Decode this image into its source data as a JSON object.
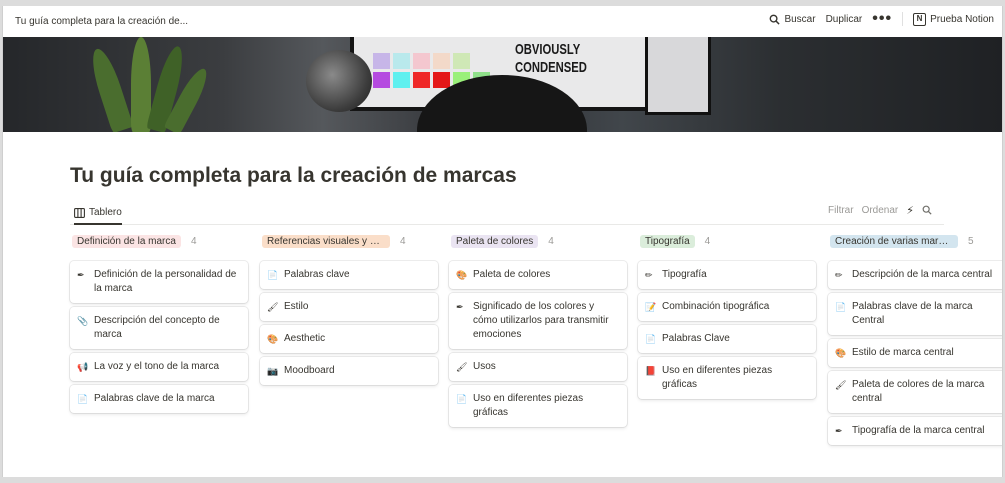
{
  "topbar": {
    "breadcrumb": "Tu guía completa para la creación de...",
    "search_label": "Buscar",
    "duplicate_label": "Duplicar",
    "more_label": "•••",
    "notion_label": "Prueba Notion"
  },
  "cover": {
    "text_line1": "OBVIOUSLY",
    "text_line2": "CONDENSED"
  },
  "page": {
    "title": "Tu guía completa para la creación de marcas"
  },
  "view": {
    "tab_label": "Tablero",
    "filter_label": "Filtrar",
    "sort_label": "Ordenar"
  },
  "columns": [
    {
      "title": "Definición de la marca",
      "count": "4",
      "color": "#fbe4e4",
      "cards": [
        {
          "icon": "pen-icon",
          "glyph": "✒",
          "text": "Definición de la personalidad de la marca"
        },
        {
          "icon": "paperclip-icon",
          "glyph": "📎",
          "text": "Descripción del concepto de marca"
        },
        {
          "icon": "megaphone-icon",
          "glyph": "📢",
          "text": "La voz y el tono de la marca"
        },
        {
          "icon": "page-icon",
          "glyph": "📄",
          "text": "Palabras clave de la marca"
        }
      ]
    },
    {
      "title": "Referencias visuales y es...",
      "count": "4",
      "color": "#fadec9",
      "cards": [
        {
          "icon": "page-icon",
          "glyph": "📄",
          "text": "Palabras clave"
        },
        {
          "icon": "paintbrush-icon",
          "glyph": "🖌",
          "text": "Estilo"
        },
        {
          "icon": "palette-icon",
          "glyph": "🎨",
          "text": "Aesthetic"
        },
        {
          "icon": "camera-icon",
          "glyph": "📷",
          "text": "Moodboard"
        }
      ]
    },
    {
      "title": "Paleta de colores",
      "count": "4",
      "color": "#eae4f2",
      "cards": [
        {
          "icon": "palette-icon",
          "glyph": "🎨",
          "text": "Paleta de colores"
        },
        {
          "icon": "pen-icon",
          "glyph": "✒",
          "text": "Significado de los colores y cómo utilizarlos para transmitir emociones"
        },
        {
          "icon": "paintbrush-icon",
          "glyph": "🖌",
          "text": "Usos"
        },
        {
          "icon": "page-icon",
          "glyph": "📄",
          "text": "Uso en diferentes piezas gráficas"
        }
      ]
    },
    {
      "title": "Tipografía",
      "count": "4",
      "color": "#dbeddb",
      "cards": [
        {
          "icon": "pencil-icon",
          "glyph": "✏",
          "text": "Tipografía"
        },
        {
          "icon": "memo-icon",
          "glyph": "📝",
          "text": "Combinación tipográfica"
        },
        {
          "icon": "page-icon",
          "glyph": "📄",
          "text": "Palabras Clave"
        },
        {
          "icon": "book-icon",
          "glyph": "📕",
          "text": "Uso en diferentes piezas gráficas"
        }
      ]
    },
    {
      "title": "Creación de varias marcas",
      "count": "5",
      "color": "#d3e5ef",
      "cards": [
        {
          "icon": "pencil-icon",
          "glyph": "✏",
          "text": "Descripción de la marca central"
        },
        {
          "icon": "page-icon",
          "glyph": "📄",
          "text": "Palabras clave de la marca Central"
        },
        {
          "icon": "palette-icon",
          "glyph": "🎨",
          "text": "Estilo de marca central"
        },
        {
          "icon": "paintbrush-icon",
          "glyph": "🖌",
          "text": "Paleta de colores de la marca central"
        },
        {
          "icon": "pen-icon",
          "glyph": "✒",
          "text": "Tipografía de la marca central"
        }
      ]
    }
  ]
}
